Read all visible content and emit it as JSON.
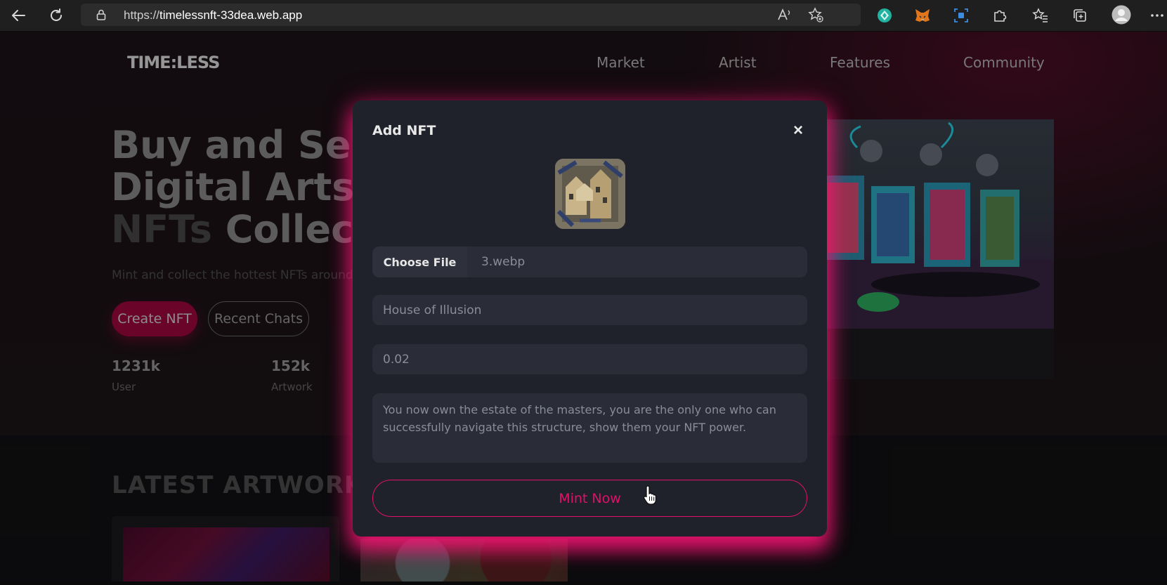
{
  "browser": {
    "url_prefix": "https://",
    "url_host": "timelessnft-33dea.web.app"
  },
  "site": {
    "logo": "TIME:LESS",
    "nav": [
      "Market",
      "Artist",
      "Features",
      "Community"
    ]
  },
  "hero": {
    "title_line1": "Buy and Sel",
    "title_line2": "Digital Arts,",
    "title_line3_dim": "NFTs",
    "title_line3": " Collec",
    "subtitle": "Mint and collect the hottest NFTs around",
    "create_button": "Create NFT",
    "chats_button": "Recent Chats",
    "stats": [
      {
        "value": "1231k",
        "label": "User"
      },
      {
        "value": "152k",
        "label": "Artwork"
      }
    ]
  },
  "latest": {
    "heading": "LATEST ARTWORKS"
  },
  "modal": {
    "title": "Add NFT",
    "close_symbol": "×",
    "choose_file_label": "Choose File",
    "file_name": "3.webp",
    "name_value": "House of Illusion",
    "price_value": "0.02",
    "description_value": "You now own the estate of the masters, you are the only one who can successfully navigate this structure, show them your NFT power.",
    "mint_button": "Mint Now"
  },
  "colors": {
    "accent": "#e0106a",
    "create_button_bg": "#a3083f",
    "modal_bg": "#20222b",
    "field_bg": "#2a2d38"
  },
  "icons": [
    "back-arrow-icon",
    "refresh-icon",
    "lock-icon",
    "read-aloud-icon",
    "favorite-add-icon",
    "extension-green-icon",
    "metamask-fox-icon",
    "screen-capture-icon",
    "puzzle-icon",
    "favorites-icon",
    "collections-icon",
    "profile-avatar-icon",
    "more-icon",
    "close-icon",
    "pointer-cursor-icon"
  ]
}
